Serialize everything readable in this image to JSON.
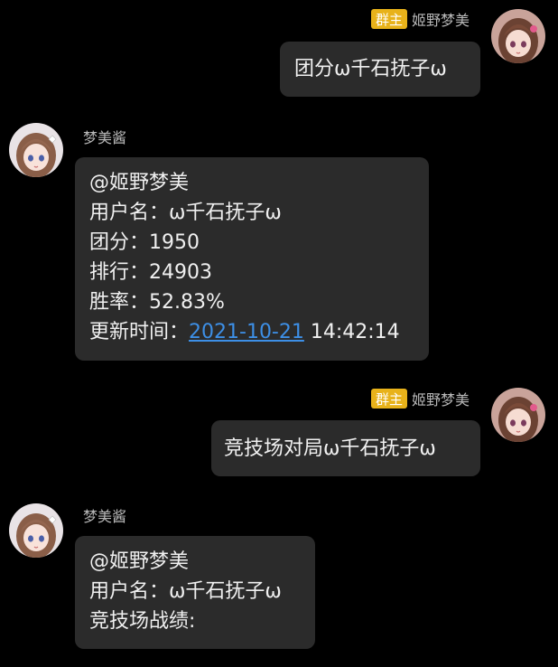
{
  "colors": {
    "background": "#000000",
    "bubble": "#2b2b2b",
    "badge": "#e8b21a",
    "link": "#3d8fe6",
    "name_text": "#b8b8b8"
  },
  "messages": [
    {
      "sender": "姬野梦美",
      "badge": "群主",
      "avatar": "sender-avatar",
      "lines": [
        "团分ω千石抚子ω"
      ]
    },
    {
      "sender": "梦美酱",
      "avatar": "bot-avatar",
      "mention": "@姬野梦美",
      "username_line": "用户名：ω千石抚子ω",
      "score_line": "团分：1950",
      "rank_line": "排行：24903",
      "winrate_line": "胜率：52.83%",
      "update_label": "更新时间：",
      "update_date": "2021-10-21",
      "update_time": " 14:42:14"
    },
    {
      "sender": "姬野梦美",
      "badge": "群主",
      "avatar": "sender-avatar",
      "lines": [
        "竞技场对局ω千石抚子ω"
      ]
    },
    {
      "sender": "梦美酱",
      "avatar": "bot-avatar",
      "mention": "@姬野梦美",
      "username_line": "用户名：ω千石抚子ω",
      "record_line": "竞技场战绩:"
    }
  ]
}
